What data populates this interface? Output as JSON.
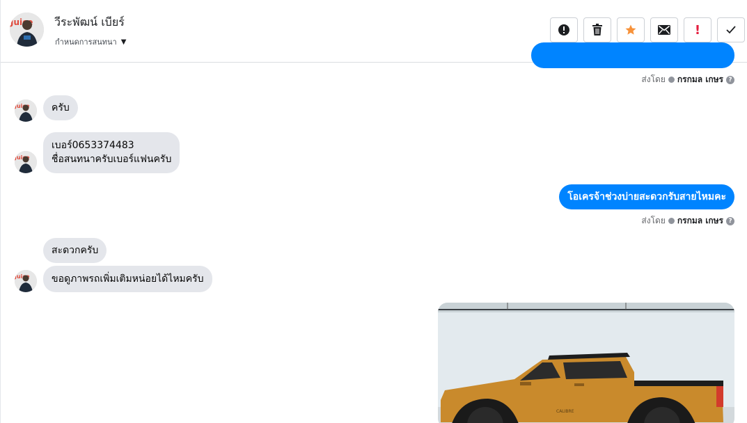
{
  "header": {
    "contact_name": "วีระพัฒน์ เบียร์",
    "subtitle": "กำหนดการสนทนา",
    "actions": [
      {
        "name": "mark-spam",
        "label": "!"
      },
      {
        "name": "delete",
        "label": ""
      },
      {
        "name": "star",
        "label": ""
      },
      {
        "name": "mark-unread",
        "label": ""
      },
      {
        "name": "follow-up",
        "label": "!"
      },
      {
        "name": "done",
        "label": ""
      }
    ]
  },
  "messages": [
    {
      "direction": "in",
      "lines": [
        "ครับ"
      ]
    },
    {
      "direction": "in",
      "lines": [
        "เบอร์0653374483",
        "ชื่อสนทนาครับเบอร์แฟนครับ"
      ]
    },
    {
      "direction": "out",
      "lines": [
        "โอเครจ้าช่วงบ่ายสะดวกรับสายไหมคะ"
      ]
    },
    {
      "direction": "in",
      "lines": [
        "สะดวกครับ"
      ]
    },
    {
      "direction": "in",
      "lines": [
        "ขอดูภาพรถเพิ่มเติมหน่อยได้ไหมครับ"
      ]
    }
  ],
  "sent_by": {
    "prefix": "ส่งโดย",
    "agent": "กรกมล เกษร"
  },
  "colors": {
    "outgoing_bubble": "#0084ff",
    "incoming_bubble": "#e4e6eb",
    "star": "#f7923a",
    "flag": "#e41e3f"
  }
}
